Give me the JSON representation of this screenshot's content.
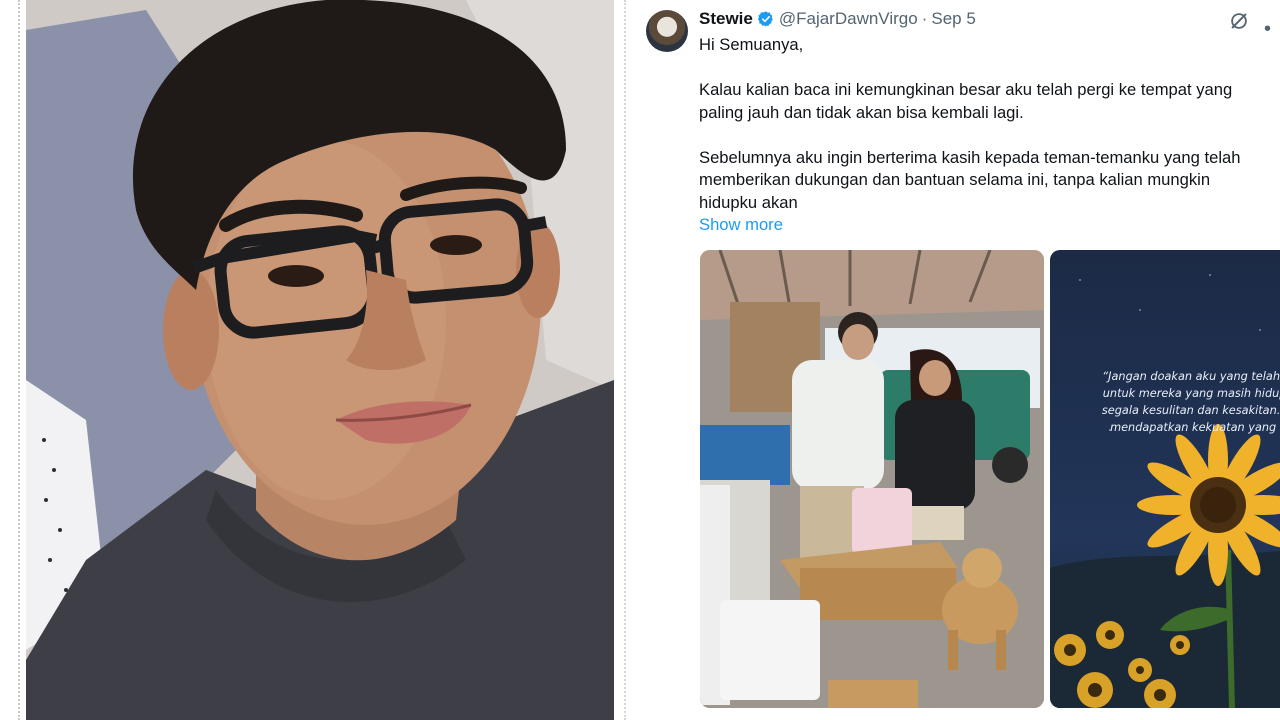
{
  "tweet": {
    "display_name": "Stewie",
    "handle": "@FajarDawnVirgo",
    "separator": "·",
    "date": "Sep 5",
    "lines": [
      "Hi Semuanya,",
      "",
      "Kalau kalian baca ini kemungkinan besar aku telah pergi ke tempat yang",
      "paling jauh dan tidak akan bisa kembali lagi.",
      "",
      "Sebelumnya aku ingin berterima kasih kepada teman-temanku yang telah",
      "memberikan dukungan dan bantuan selama ini, tanpa kalian mungkin",
      "hidupku akan"
    ],
    "show_more": "Show more",
    "media2_quote_lines": [
      "“Jangan doakan aku yang telah pe",
      "untuk mereka yang masih hidup p",
      "segala kesulitan dan kesakitan. Se",
      "mendapatkan kekuatan yang le"
    ]
  },
  "colors": {
    "accent": "#1d9bf0",
    "secondary_text": "#536471",
    "primary_text": "#0f1419"
  },
  "icons": [
    "verified-badge-icon",
    "grok-icon",
    "more-options-icon"
  ]
}
